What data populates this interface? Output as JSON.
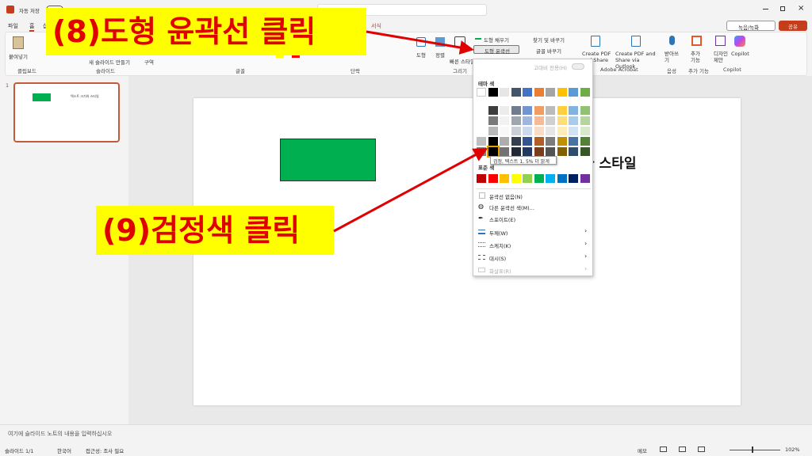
{
  "titlebar": {
    "autosave": "자동 저장",
    "autosave_state": "끔",
    "record_button": "녹음/녹화",
    "share_button": "공유"
  },
  "tabs": [
    "파일",
    "홈",
    "삽입",
    "서식"
  ],
  "ribbon": {
    "paste": "붙여넣기",
    "new_slide": "새 슬라이드 만들기",
    "section": "구역",
    "groups": [
      "클립보드",
      "슬라이드",
      "글꼴",
      "단락",
      "그리기",
      "Adobe Acrobat",
      "음성",
      "추가 기능",
      "Copilot"
    ],
    "shape": "도형",
    "arrange": "정렬",
    "quick_styles": "빠른 스타일",
    "shape_fill": "도형 채우기",
    "shape_outline": "도형 윤곽선",
    "find_replace": "찾기 및 바꾸기",
    "font_replace": "글꼴 바꾸기",
    "create_pdf": "Create PDF and Share link",
    "create_pdf_outlook": "Create PDF and Share via Outlook",
    "dictate": "받아쓰기",
    "addins": "추가 기능",
    "designer": "디자인 제안",
    "copilot": "Copilot"
  },
  "callouts": {
    "step8": "(8)도형 윤곽선 클릭",
    "step9": "(9)검정색 클릭"
  },
  "slide": {
    "thumb_number": "1",
    "thumb_text": "텍스트 크기와 스타일",
    "visible_text": "나 스타일",
    "shape_color": "#00b050"
  },
  "outline_menu": {
    "header_toggle": "고대비 전용(H)",
    "theme_colors_label": "테마 색",
    "standard_colors_label": "표준 색",
    "tooltip": "검정, 텍스트 1, 5% 더 밝게",
    "items": [
      "윤곽선 없음(N)",
      "다른 윤곽선 색(M)...",
      "스포이트(E)",
      "두께(W)",
      "스케치(K)",
      "대시(S)",
      "화살표(R)"
    ],
    "theme_top": [
      "#ffffff",
      "#000000",
      "#e7e6e6",
      "#44546a",
      "#4472c4",
      "#ed7d31",
      "#a5a5a5",
      "#ffc000",
      "#5b9bd5",
      "#70ad47"
    ],
    "standard": [
      "#c00000",
      "#ff0000",
      "#ffc000",
      "#ffff00",
      "#92d050",
      "#00b050",
      "#00b0f0",
      "#0070c0",
      "#002060",
      "#7030a0"
    ]
  },
  "notes": {
    "placeholder": "여기에 슬라이드 노트의 내용을 입력하십시오"
  },
  "status": {
    "slide": "슬라이드 1/1",
    "language": "한국어",
    "accessibility": "접근성: 조사 필요",
    "notes": "메모",
    "zoom": "102%"
  }
}
